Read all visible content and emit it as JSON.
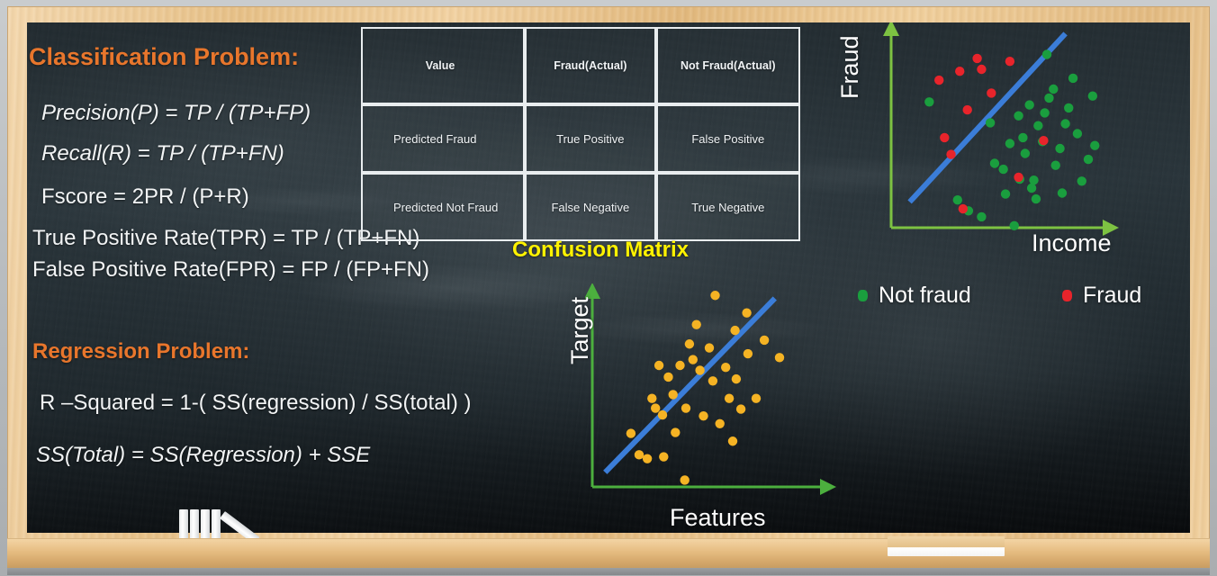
{
  "slide": {
    "background": "chalkboard",
    "frame_color": "#e7c188",
    "board_color": "#242e34",
    "accent_orange": "#E8762C",
    "caption_yellow": "#FFF200"
  },
  "left_panel": {
    "classification_heading": "Classification Problem:",
    "classification_formulas": [
      "Precision(P) = TP / (TP+FP)",
      "Recall(R) = TP / (TP+FN)",
      "Fscore = 2PR / (P+R)",
      "True Positive Rate(TPR) = TP / (TP+FN)",
      "False Positive Rate(FPR) = FP / (FP+FN)"
    ],
    "regression_heading": "Regression Problem:",
    "regression_formulas": [
      "R –Squared = 1-( SS(regression) / SS(total) )",
      "SS(Total) = SS(Regression) + SSE"
    ]
  },
  "confusion_matrix": {
    "caption": "Confusion Matrix",
    "headers": [
      "Value",
      "Fraud(Actual)",
      "Not Fraud(Actual)"
    ],
    "rows": [
      {
        "label": "Predicted Fraud",
        "cells": [
          "True Positive",
          "False Positive"
        ]
      },
      {
        "label": "Predicted Not Fraud",
        "cells": [
          "False Negative",
          "True Negative"
        ]
      }
    ]
  },
  "chart_data": [
    {
      "id": "classification-scatter",
      "type": "scatter",
      "title": "",
      "xlabel": "Income",
      "ylabel": "Fraud",
      "grid": false,
      "legend_position": "below",
      "axis_color": "#7DC242",
      "boundary_line": {
        "color": "#3B7DD8",
        "x0": 0.085,
        "y0": 0.13,
        "x1": 0.8,
        "y1": 0.98
      },
      "series": [
        {
          "name": "Not fraud",
          "color": "#1a9e3e",
          "points": [
            [
              0.175,
              0.635
            ],
            [
              0.305,
              0.14
            ],
            [
              0.355,
              0.085
            ],
            [
              0.415,
              0.055
            ],
            [
              0.455,
              0.53
            ],
            [
              0.475,
              0.325
            ],
            [
              0.515,
              0.295
            ],
            [
              0.525,
              0.17
            ],
            [
              0.545,
              0.425
            ],
            [
              0.565,
              0.01
            ],
            [
              0.585,
              0.565
            ],
            [
              0.59,
              0.245
            ],
            [
              0.605,
              0.455
            ],
            [
              0.615,
              0.375
            ],
            [
              0.635,
              0.62
            ],
            [
              0.645,
              0.2
            ],
            [
              0.655,
              0.24
            ],
            [
              0.665,
              0.145
            ],
            [
              0.675,
              0.515
            ],
            [
              0.695,
              0.435
            ],
            [
              0.705,
              0.58
            ],
            [
              0.715,
              0.875
            ],
            [
              0.725,
              0.655
            ],
            [
              0.745,
              0.7
            ],
            [
              0.755,
              0.315
            ],
            [
              0.775,
              0.4
            ],
            [
              0.785,
              0.175
            ],
            [
              0.8,
              0.525
            ],
            [
              0.815,
              0.605
            ],
            [
              0.835,
              0.755
            ],
            [
              0.855,
              0.475
            ],
            [
              0.875,
              0.235
            ],
            [
              0.905,
              0.345
            ],
            [
              0.925,
              0.665
            ],
            [
              0.935,
              0.415
            ]
          ]
        },
        {
          "name": "Fraud",
          "color": "#E8242B",
          "points": [
            [
              0.22,
              0.745
            ],
            [
              0.245,
              0.455
            ],
            [
              0.275,
              0.37
            ],
            [
              0.315,
              0.79
            ],
            [
              0.33,
              0.095
            ],
            [
              0.35,
              0.595
            ],
            [
              0.395,
              0.855
            ],
            [
              0.415,
              0.8
            ],
            [
              0.46,
              0.68
            ],
            [
              0.545,
              0.84
            ],
            [
              0.585,
              0.255
            ],
            [
              0.7,
              0.44
            ]
          ]
        }
      ]
    },
    {
      "id": "regression-scatter",
      "type": "scatter",
      "title": "",
      "xlabel": "Features",
      "ylabel": "Target",
      "grid": false,
      "legend_position": "none",
      "axis_color": "#4CAF3E",
      "fit_line": {
        "color": "#3B7DD8",
        "x0": 0.055,
        "y0": 0.075,
        "x1": 0.78,
        "y1": 0.97
      },
      "series": [
        {
          "name": "Observations",
          "color": "#F5B324",
          "points": [
            [
              0.165,
              0.275
            ],
            [
              0.2,
              0.165
            ],
            [
              0.235,
              0.145
            ],
            [
              0.255,
              0.455
            ],
            [
              0.27,
              0.405
            ],
            [
              0.285,
              0.625
            ],
            [
              0.3,
              0.37
            ],
            [
              0.305,
              0.155
            ],
            [
              0.325,
              0.565
            ],
            [
              0.345,
              0.475
            ],
            [
              0.355,
              0.28
            ],
            [
              0.375,
              0.625
            ],
            [
              0.395,
              0.035
            ],
            [
              0.4,
              0.405
            ],
            [
              0.415,
              0.735
            ],
            [
              0.43,
              0.655
            ],
            [
              0.445,
              0.835
            ],
            [
              0.46,
              0.6
            ],
            [
              0.475,
              0.365
            ],
            [
              0.5,
              0.715
            ],
            [
              0.515,
              0.545
            ],
            [
              0.525,
              0.985
            ],
            [
              0.545,
              0.325
            ],
            [
              0.57,
              0.615
            ],
            [
              0.585,
              0.455
            ],
            [
              0.6,
              0.235
            ],
            [
              0.61,
              0.805
            ],
            [
              0.615,
              0.555
            ],
            [
              0.635,
              0.4
            ],
            [
              0.66,
              0.895
            ],
            [
              0.665,
              0.685
            ],
            [
              0.7,
              0.455
            ],
            [
              0.735,
              0.755
            ],
            [
              0.8,
              0.665
            ]
          ]
        }
      ]
    }
  ],
  "legend": {
    "items": [
      {
        "label": "Not fraud",
        "color": "#1a9e3e"
      },
      {
        "label": "Fraud",
        "color": "#E8242B"
      }
    ]
  },
  "props": {
    "chalk_sticks": 4,
    "eraser": "eraser"
  }
}
